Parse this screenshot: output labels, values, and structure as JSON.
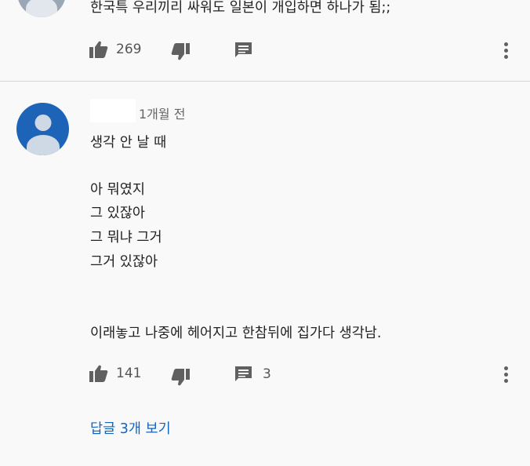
{
  "top_comment": {
    "text": "한국특 우리끼리 싸워도 일본이 개입하면 하나가 됨;;",
    "like_count": "269"
  },
  "comment": {
    "time": "1개월 전",
    "lines": [
      "생각 안 날 때",
      "아 뭐였지",
      "그 있잖아",
      "그 뭐냐 그거",
      "그거 있잖아",
      "이래놓고 나중에 헤어지고 한참뒤에 집가다 생각남."
    ],
    "like_count": "141",
    "reply_count": "3",
    "view_replies_label": "답글 3개 보기"
  },
  "icons": {
    "like": "thumbs-up-icon",
    "dislike": "thumbs-down-icon",
    "reply": "comment-icon",
    "more": "more-vert-icon"
  },
  "colors": {
    "link": "#1065c0",
    "avatar": "#1d64b8",
    "icon": "#606060"
  }
}
